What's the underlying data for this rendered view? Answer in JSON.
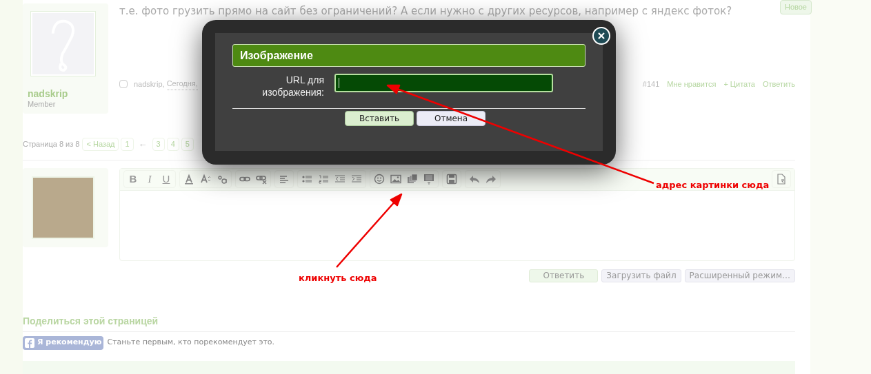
{
  "post": {
    "message": "т.е. фото грузить прямо на сайт без ограничений? А если нужно с других ресурсов, например с яндекс фоток?",
    "badge": "Новое",
    "author": {
      "name": "nadskrip",
      "role": "Member"
    },
    "checked": false,
    "meta_author": "nadskrip,",
    "meta_date": "Сегодня,",
    "number": "#141",
    "actions": [
      "Мне нравится",
      "+ Цитата",
      "Ответить"
    ]
  },
  "pagination": {
    "label": "Страница 8 из 8",
    "items": [
      {
        "label": "< Назад",
        "kind": "link"
      },
      {
        "label": "1",
        "kind": "link"
      },
      {
        "label": "←",
        "kind": "gap"
      },
      {
        "label": "3",
        "kind": "link"
      },
      {
        "label": "4",
        "kind": "link"
      },
      {
        "label": "5",
        "kind": "link"
      }
    ]
  },
  "editor": {
    "format_buttons": [
      "B",
      "I",
      "U"
    ],
    "buttons": [
      {
        "label": "Ответить",
        "kind": "primary"
      },
      {
        "label": "Загрузить файл",
        "kind": "default"
      },
      {
        "label": "Расширенный режим…",
        "kind": "default"
      }
    ]
  },
  "share": {
    "title": "Поделиться этой страницей",
    "like_button": "Я рекомендую",
    "note": "Станьте первым, кто порекомендует это."
  },
  "dialog": {
    "title": "Изображение",
    "url_label": "URL для изображения:",
    "buttons": [
      {
        "label": "Вставить",
        "kind": "primary"
      },
      {
        "label": "Отмена",
        "kind": "default"
      }
    ]
  },
  "annotations": [
    {
      "text": "адрес картинки сюда"
    },
    {
      "text": "кликнуть сюда"
    }
  ]
}
